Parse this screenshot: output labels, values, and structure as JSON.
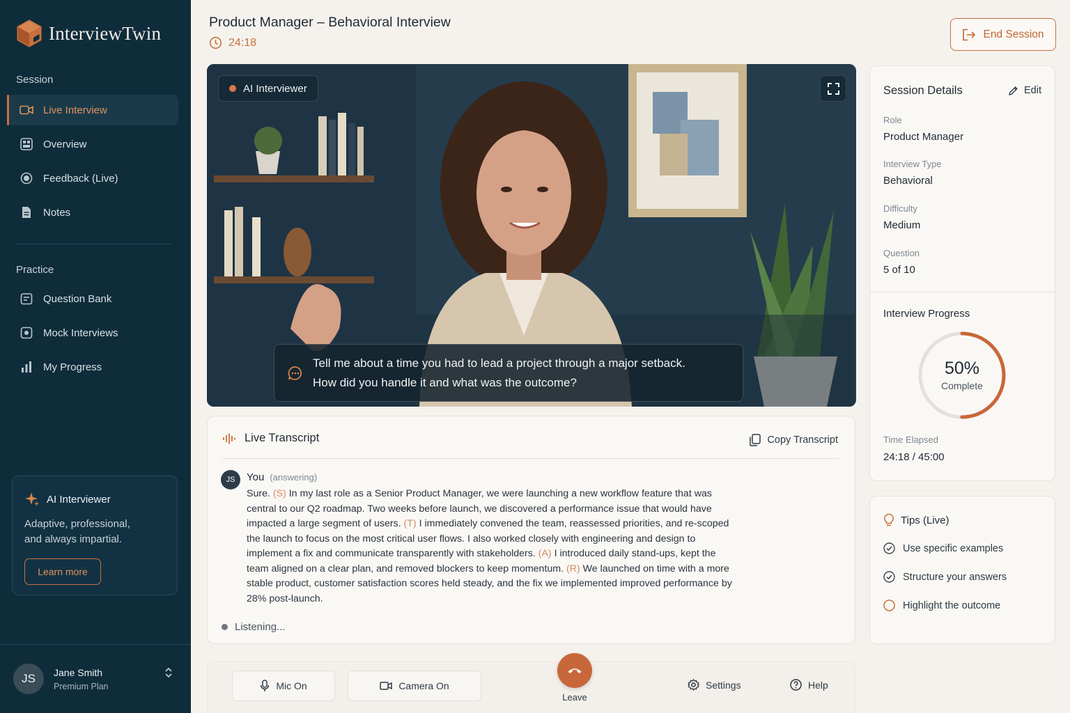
{
  "app": {
    "name": "InterviewTwin"
  },
  "sidebar": {
    "session_label": "Session",
    "session_items": [
      {
        "label": "Live Interview",
        "icon": "video-camera-icon",
        "active": true
      },
      {
        "label": "Overview",
        "icon": "overview-icon"
      },
      {
        "label": "Feedback (Live)",
        "icon": "feedback-icon"
      },
      {
        "label": "Notes",
        "icon": "notes-icon"
      }
    ],
    "practice_label": "Practice",
    "practice_items": [
      {
        "label": "Question Bank",
        "icon": "question-bank-icon"
      },
      {
        "label": "Mock Interviews",
        "icon": "mock-interviews-icon"
      },
      {
        "label": "My Progress",
        "icon": "bar-chart-icon"
      }
    ],
    "promo": {
      "title": "AI Interviewer",
      "text": "Adaptive, professional, and always impartial.",
      "button": "Learn more"
    },
    "user": {
      "initials": "JS",
      "name": "Jane Smith",
      "plan": "Premium Plan"
    }
  },
  "header": {
    "title": "Product Manager – Behavioral Interview",
    "timer": "24:18",
    "end_button": "End Session"
  },
  "video": {
    "badge": "AI Interviewer",
    "question_line1": "Tell me about a time you had to lead a project through a major setback.",
    "question_line2": "How did you handle it and what was the outcome?"
  },
  "transcript": {
    "title": "Live Transcript",
    "copy_label": "Copy Transcript",
    "speaker_initials": "JS",
    "speaker": "You",
    "speaker_status": "(answering)",
    "segments": [
      {
        "text": "Sure. "
      },
      {
        "tag": "(S)",
        "text": " In my last role as a Senior Product Manager, we were launching a new workflow feature that was central to our Q2 roadmap. Two weeks before launch, we discovered a performance issue that would have impacted a large segment of users. "
      },
      {
        "tag": "(T)",
        "text": " I immediately convened the team, reassessed priorities, and re-scoped the launch to focus on the most critical user flows. I also worked closely with engineering and design to implement a fix and communicate transparently with stakeholders. "
      },
      {
        "tag": "(A)",
        "text": " I introduced daily stand-ups, kept the team aligned on a clear plan, and removed blockers to keep momentum. "
      },
      {
        "tag": "(R)",
        "text": " We launched on time with a more stable product, customer satisfaction scores held steady, and the fix we implemented improved performance by 28% post-launch."
      }
    ],
    "listening": "Listening..."
  },
  "controls": {
    "mic": "Mic On",
    "camera": "Camera On",
    "leave": "Leave",
    "settings": "Settings",
    "help": "Help"
  },
  "details": {
    "title": "Session Details",
    "edit": "Edit",
    "fields": [
      {
        "label": "Role",
        "value": "Product Manager"
      },
      {
        "label": "Interview Type",
        "value": "Behavioral"
      },
      {
        "label": "Difficulty",
        "value": "Medium"
      },
      {
        "label": "Question",
        "value": "5 of 10"
      }
    ],
    "progress_title": "Interview Progress",
    "progress_value": 0.5,
    "progress_pct": "50%",
    "progress_sub": "Complete",
    "elapsed_label": "Time Elapsed",
    "elapsed_value": "24:18 / 45:00"
  },
  "tips": {
    "title": "Tips (Live)",
    "items": [
      {
        "label": "Use specific examples",
        "done": true
      },
      {
        "label": "Structure your answers",
        "done": true
      },
      {
        "label": "Highlight the outcome",
        "done": false
      }
    ]
  },
  "colors": {
    "accent": "#c8703c",
    "sidebar_bg": "#0f2c3b",
    "page_bg": "#f5f2ee"
  }
}
